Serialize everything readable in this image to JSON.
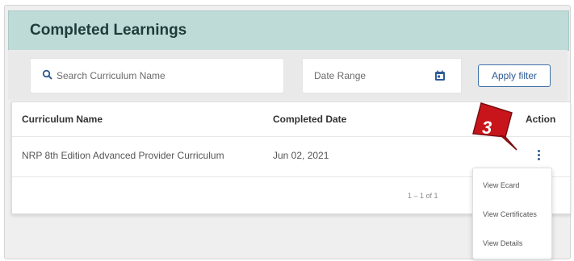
{
  "header": {
    "title": "Completed Learnings"
  },
  "filters": {
    "search_placeholder": "Search Curriculum Name",
    "date_placeholder": "Date Range",
    "apply_label": "Apply filter"
  },
  "table": {
    "columns": [
      "Curriculum Name",
      "Completed Date",
      "Action"
    ],
    "rows": [
      {
        "name": "NRP 8th Edition Advanced Provider Curriculum",
        "date": "Jun 02, 2021"
      }
    ],
    "pagination": {
      "range": "1 – 1 of 1",
      "tail": "|"
    }
  },
  "callout": {
    "number": "3"
  },
  "action_menu": {
    "items": [
      "View Ecard",
      "View Certificates",
      "View Details"
    ]
  },
  "colors": {
    "header_bg": "#bfdbd8",
    "accent": "#2e5c94",
    "callout": "#c8151b"
  },
  "icons": {
    "search": "search-icon",
    "date": "calendar-icon",
    "action": "more-vertical-icon"
  }
}
